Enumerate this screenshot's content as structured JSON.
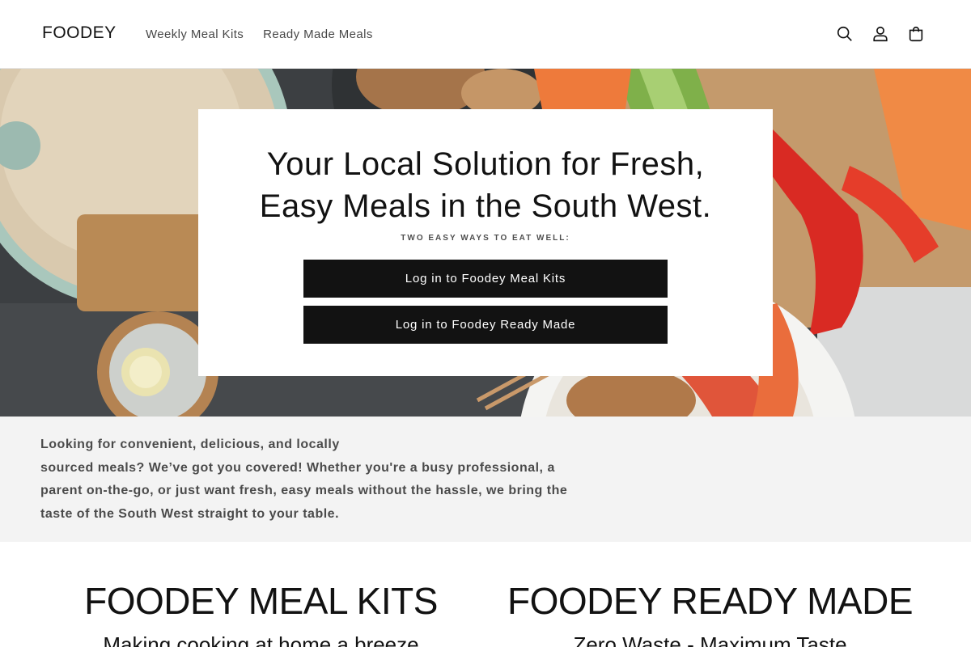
{
  "header": {
    "logo": "FOODEY",
    "nav": [
      "Weekly Meal Kits",
      "Ready Made Meals"
    ],
    "icons": [
      "search-icon",
      "account-icon",
      "cart-icon"
    ]
  },
  "hero": {
    "title": "Your Local Solution for Fresh, Easy Meals in the South West.",
    "subtitle": "TWO EASY WAYS TO EAT WELL:",
    "buttons": [
      "Log in to Foodey Meal Kits",
      "Log in to Foodey Ready Made"
    ]
  },
  "intro": {
    "text": "Looking for convenient, delicious, and locally\nsourced meals? We’ve got you covered! Whether you're a busy professional, a parent on-the-go, or just want fresh, easy meals without the hassle, we bring the taste of the South West straight to your table."
  },
  "columns": [
    {
      "title": "FOODEY MEAL KITS",
      "subtitle": "Making cooking at home a breeze"
    },
    {
      "title": "FOODEY READY MADE",
      "subtitle": "Zero Waste - Maximum Taste"
    }
  ],
  "colors": {
    "text": "#121212",
    "button_bg": "#121212",
    "intro_bg": "#f3f3f3",
    "hero_bg": "#3b3e41"
  }
}
